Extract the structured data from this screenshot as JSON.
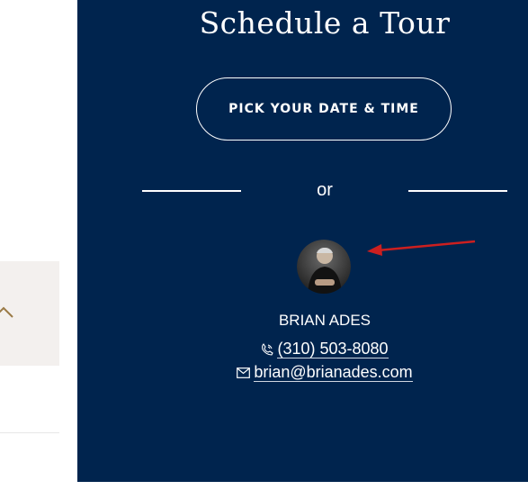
{
  "tour": {
    "title": "Schedule a Tour",
    "button_label": "PICK YOUR DATE & TIME",
    "separator_text": "or",
    "agent": {
      "name": "BRIAN ADES",
      "phone": "(310) 503-8080",
      "email": "brian@brianades.com"
    }
  },
  "colors": {
    "panel_bg": "#00244e",
    "annotation_arrow": "#cc1f1f",
    "left_card_bg": "#f3f0ee",
    "chevron": "#9a7a45"
  },
  "icons": {
    "chevron": "chevron-up-icon",
    "phone": "phone-icon",
    "email": "mail-icon"
  }
}
